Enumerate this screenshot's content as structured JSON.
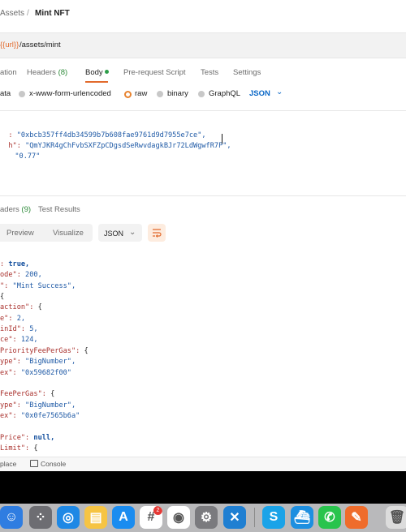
{
  "breadcrumb": {
    "parent": "Assets",
    "separator": "/",
    "current": "Mint NFT"
  },
  "url": {
    "variable": "{{url}}",
    "path": "/assets/mint"
  },
  "request_tabs": {
    "authorization": "ation",
    "headers": "Headers",
    "headers_count": "(8)",
    "body": "Body",
    "pre_request": "Pre-request Script",
    "tests": "Tests",
    "settings": "Settings"
  },
  "body_types": {
    "form_data": "ata",
    "urlencoded": "x-www-form-urlencoded",
    "raw": "raw",
    "binary": "binary",
    "graphql": "GraphQL",
    "format": "JSON"
  },
  "request_body": {
    "line1_key": ":",
    "line1_value": "\"0xbcb357ff4db34599b7b608fae9761d9d7955e7ce\",",
    "line2_key": "h\":",
    "line2_value": "\"QmYJKR4gChFvbSXFZpCDgsdSeRwvdagkBJr72LdWgwfR7P\",",
    "line3_value": "\"0.77\""
  },
  "response_tabs": {
    "headers": "aders",
    "headers_count": "(9)",
    "test_results": "Test Results"
  },
  "response_toolbar": {
    "preview": "Preview",
    "visualize": "Visualize",
    "format": "JSON"
  },
  "response_body": [
    {
      "key": ":",
      "val": " true,",
      "vclass": "b"
    },
    {
      "key": "ode\":",
      "val": " 200,",
      "vclass": "n"
    },
    {
      "key": "\":",
      "val": " \"Mint Success\",",
      "vclass": "s"
    },
    {
      "key": "",
      "val": "{",
      "vclass": "p"
    },
    {
      "key": "action\":",
      "val": " {",
      "vclass": "p"
    },
    {
      "key": "e\":",
      "val": " 2,",
      "vclass": "n"
    },
    {
      "key": "inId\":",
      "val": " 5,",
      "vclass": "n"
    },
    {
      "key": "ce\":",
      "val": " 124,",
      "vclass": "n"
    },
    {
      "key": "PriorityFeePerGas\":",
      "val": " {",
      "vclass": "p"
    },
    {
      "key": "ype\":",
      "val": " \"BigNumber\",",
      "vclass": "s"
    },
    {
      "key": "ex\":",
      "val": " \"0x59682f00\"",
      "vclass": "s"
    },
    {
      "key": "",
      "val": "",
      "vclass": "p"
    },
    {
      "key": "FeePerGas\":",
      "val": " {",
      "vclass": "p"
    },
    {
      "key": "ype\":",
      "val": " \"BigNumber\",",
      "vclass": "s"
    },
    {
      "key": "ex\":",
      "val": " \"0x0fe7565b6a\"",
      "vclass": "s"
    },
    {
      "key": "",
      "val": "",
      "vclass": "p"
    },
    {
      "key": "Price\":",
      "val": " null,",
      "vclass": "b"
    },
    {
      "key": "Limit\":",
      "val": " {",
      "vclass": "p"
    }
  ],
  "status_bar": {
    "replace": "place",
    "console": "Console"
  },
  "dock": {
    "icons": [
      {
        "name": "finder-icon",
        "color": "#2f7de1"
      },
      {
        "name": "launchpad-icon",
        "color": "#6d6d72"
      },
      {
        "name": "safari-icon",
        "color": "#1e88e5"
      },
      {
        "name": "notes-icon",
        "color": "#f6c443"
      },
      {
        "name": "app-store-icon",
        "color": "#1a8cf0"
      },
      {
        "name": "slack-icon",
        "color": "#ffffff"
      },
      {
        "name": "chrome-icon",
        "color": "#ffffff"
      },
      {
        "name": "system-settings-icon",
        "color": "#7a7a7e"
      },
      {
        "name": "vscode-icon",
        "color": "#1f7fd2"
      },
      {
        "name": "skype-icon",
        "color": "#1aa3e8"
      },
      {
        "name": "docker-icon",
        "color": "#1d8fe0"
      },
      {
        "name": "whatsapp-icon",
        "color": "#29c44d"
      },
      {
        "name": "postman-icon",
        "color": "#ef6c2b"
      },
      {
        "name": "trash-icon",
        "color": "#dcdcdc"
      }
    ],
    "slack_badge": "2"
  }
}
